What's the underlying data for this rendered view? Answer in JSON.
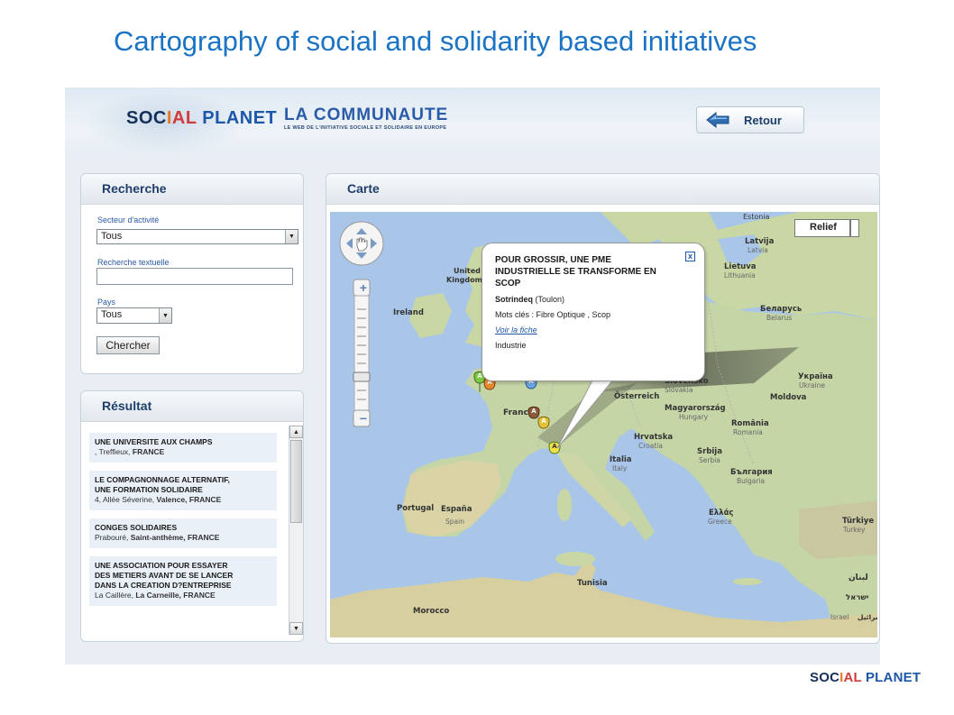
{
  "slide": {
    "title": "Cartography of social and solidarity based initiatives"
  },
  "header": {
    "logo_parts": [
      "SOC",
      "I",
      "AL",
      " PLANET"
    ],
    "communaute_title": "LA COMMUNAUTE",
    "communaute_tagline": "LE WEB DE L'INITIATIVE SOCIALE ET SOLIDAIRE EN EUROPE",
    "retour_label": "Retour"
  },
  "search": {
    "title": "Recherche",
    "sector_label": "Secteur d'activité",
    "sector_value": "Tous",
    "text_label": "Recherche textuelle",
    "text_value": "",
    "country_label": "Pays",
    "country_value": "Tous",
    "submit_label": "Chercher"
  },
  "results": {
    "title": "Résultat",
    "items": [
      {
        "title": "UNE UNIVERSITE AUX CHAMPS",
        "title2": "",
        "title3": "",
        "addr": ", Treffieux,",
        "place": " FRANCE"
      },
      {
        "title": "LE COMPAGNONNAGE ALTERNATIF,",
        "title2": "UNE FORMATION SOLIDAIRE",
        "title3": "",
        "addr": "4, Allée Séverine,",
        "place": " Valence, FRANCE"
      },
      {
        "title": "CONGES SOLIDAIRES",
        "title2": "",
        "title3": "",
        "addr": "Prabouré,",
        "place": " Saint-anthème, FRANCE"
      },
      {
        "title": "UNE ASSOCIATION POUR ESSAYER",
        "title2": "DES METIERS AVANT DE SE LANCER",
        "title3": "DANS LA CREATION D?ENTREPRISE",
        "addr": "La Caillère,",
        "place": " La Carneille, FRANCE"
      }
    ]
  },
  "map": {
    "title": "Carte",
    "map_type_relief": "Relief",
    "zoom_in": "+",
    "zoom_out": "−",
    "labels": {
      "estonia": "Estonia",
      "latvija": "Latvija",
      "latvia": "Latvia",
      "lietuva": "Lietuva",
      "lithuania": "Lithuania",
      "belarus_native": "Беларусь",
      "belarus": "Belarus",
      "ukraine_native": "Україна",
      "ukraine": "Ukraine",
      "moldova": "Moldova",
      "united": "United",
      "kingdom": "Kingdom",
      "ireland": "Ireland",
      "france": "France",
      "osterreich": "Österreich",
      "slovensko": "Slovensko",
      "slovakia": "Slovakia",
      "magyarorszag": "Magyarország",
      "hungary": "Hungary",
      "romania_native": "România",
      "romania": "Romania",
      "hrvatska": "Hrvatska",
      "croatia": "Croatia",
      "srbija": "Srbija",
      "serbia": "Serbia",
      "bulgaria_native": "България",
      "bulgaria": "Bulgaria",
      "italia": "Italia",
      "italy": "Italy",
      "ellas": "Ελλάς",
      "greece": "Greece",
      "turkiye": "Türkiye",
      "turkey": "Turkey",
      "portugal": "Portugal",
      "espana": "España",
      "spain": "Spain",
      "tunisia": "Tunisia",
      "morocco": "Morocco",
      "lebanon": "لبنان",
      "israel_he": "ישראל",
      "israel": "Israel",
      "israel_ar": "إسرائيل"
    },
    "popup": {
      "title": "POUR GROSSIR, UNE PME INDUSTRIELLE SE TRANSFORME EN SCOP",
      "org": "Sotrindeq",
      "org_city": " (Toulon)",
      "keywords": "Mots clés : Fibre Optique , Scop",
      "link": "Voir la fiche",
      "sector": "Industrie",
      "close": "x"
    },
    "marker_letters": [
      "A",
      "A",
      "A",
      "A",
      "A",
      "A"
    ]
  },
  "footer": {
    "logo_parts": [
      "SOC",
      "I",
      "AL",
      " PLANET"
    ]
  }
}
